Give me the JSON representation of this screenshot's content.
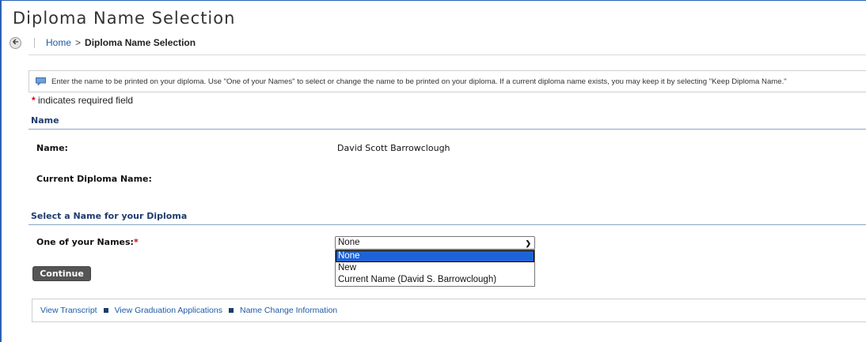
{
  "page": {
    "title": "Diploma Name Selection"
  },
  "breadcrumb": {
    "home": "Home",
    "separator": ">",
    "current": "Diploma Name Selection"
  },
  "info": {
    "message": "Enter the name to be printed on your diploma. Use \"One of your Names\" to select or change the name to be printed on your diploma. If a current diploma name exists, you may keep it by selecting \"Keep Diploma Name.\""
  },
  "required_note": {
    "star": "*",
    "text": "indicates required field"
  },
  "name_section": {
    "heading": "Name",
    "name_label": "Name:",
    "name_value": "David Scott Barrowclough",
    "current_diploma_label": "Current Diploma Name:",
    "current_diploma_value": ""
  },
  "select_section": {
    "heading": "Select a Name for your Diploma",
    "field_label": "One of your Names:",
    "field_star": "*",
    "selected_value": "None",
    "options": [
      "None",
      "New",
      "Current Name (David S. Barrowclough)"
    ]
  },
  "actions": {
    "continue_label": "Continue"
  },
  "footer_links": {
    "transcript": "View Transcript",
    "graduation": "View Graduation Applications",
    "name_change": "Name Change Information"
  },
  "colors": {
    "link": "#1f5aa6",
    "section_heading": "#1e3c6e",
    "required_star": "#d0021b",
    "selected_option": "#1e63d6",
    "button": "#555555"
  }
}
